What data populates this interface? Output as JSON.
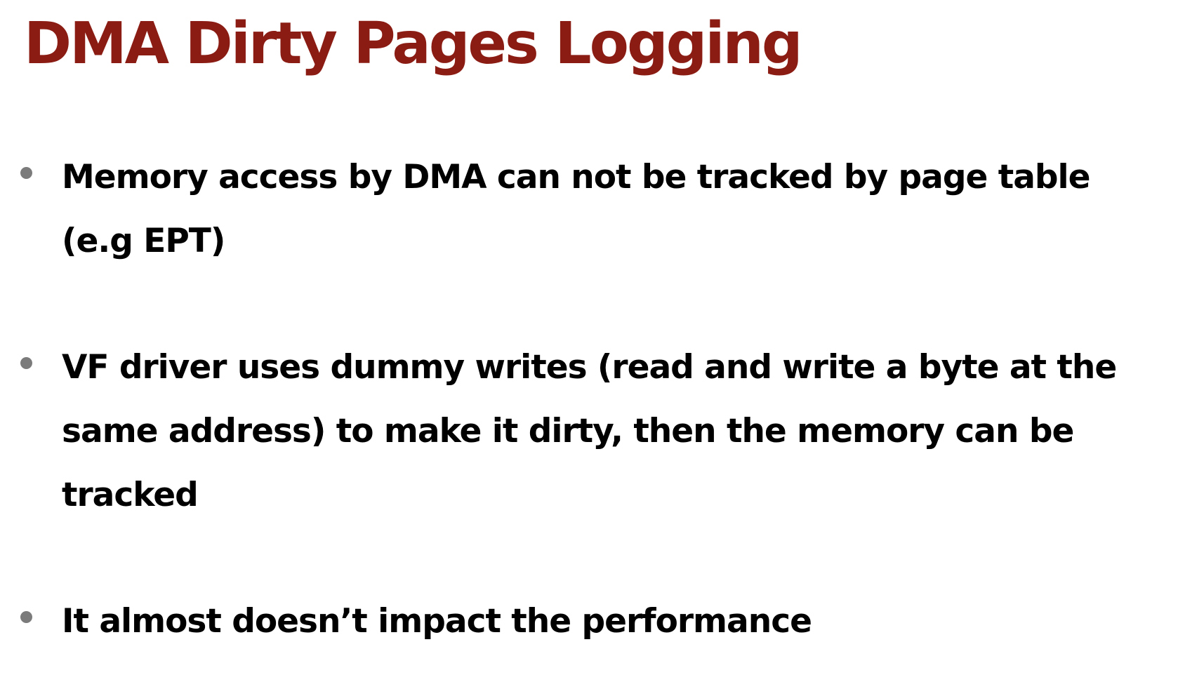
{
  "slide": {
    "title": "DMA Dirty Pages Logging",
    "bullets": [
      {
        "text": "Memory access by DMA can not be tracked by page table (e.g EPT)"
      },
      {
        "text": "VF driver uses dummy writes (read and write a byte at the same address) to make it dirty, then the memory can be tracked"
      },
      {
        "text": "It almost doesn’t impact the performance"
      }
    ]
  },
  "colors": {
    "title": "#8b1c14",
    "text": "#000000",
    "bullet_dot": "#7b7b7b",
    "background": "#ffffff"
  }
}
